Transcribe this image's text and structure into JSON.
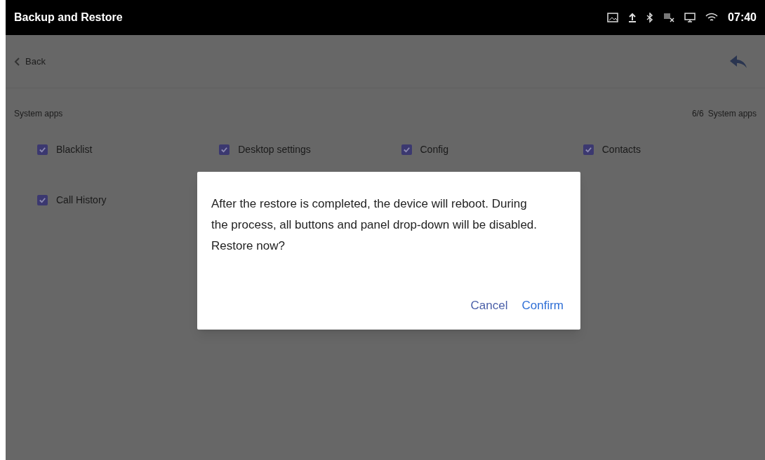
{
  "status_bar": {
    "title": "Backup and Restore",
    "time": "07:40"
  },
  "toolbar": {
    "back_label": "Back"
  },
  "section": {
    "title": "System apps",
    "count": "6/6",
    "count_label": "System apps"
  },
  "apps": [
    {
      "label": "Blacklist",
      "checked": true
    },
    {
      "label": "Desktop settings",
      "checked": true
    },
    {
      "label": "Config",
      "checked": true
    },
    {
      "label": "Contacts",
      "checked": true
    },
    {
      "label": "Call History",
      "checked": true
    }
  ],
  "dialog": {
    "message": "After the restore is completed, the device will reboot. During the process, all buttons and panel drop-down will be disabled. Restore now?",
    "buttons": [
      {
        "label": "Cancel",
        "kind": "secondary"
      },
      {
        "label": "Confirm",
        "kind": "primary"
      }
    ]
  }
}
